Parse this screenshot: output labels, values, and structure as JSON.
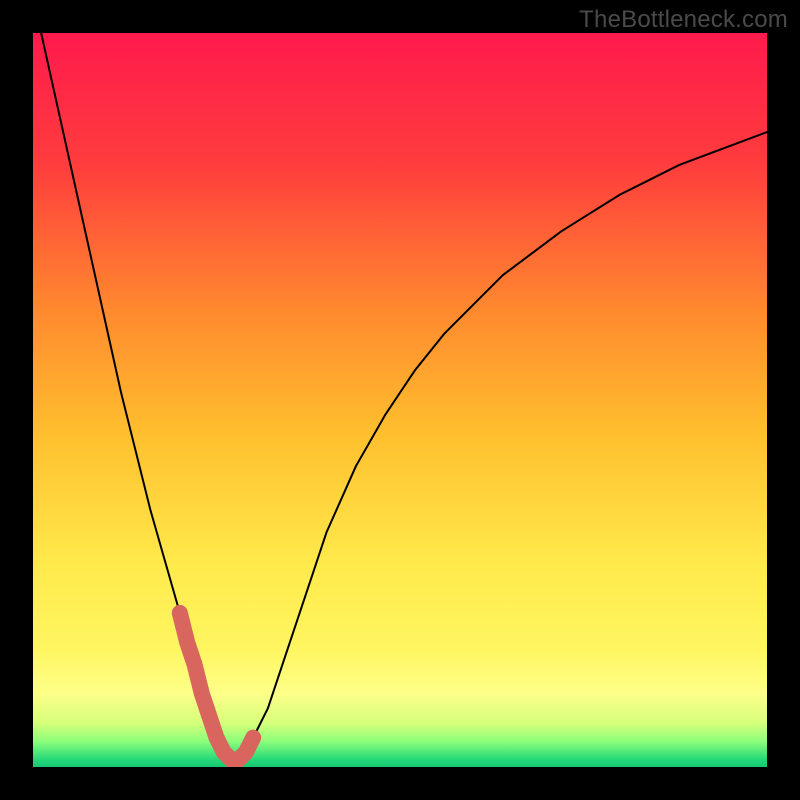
{
  "watermark": "TheBottleneck.com",
  "chart_data": {
    "type": "line",
    "title": "",
    "xlabel": "",
    "ylabel": "",
    "xlim": [
      0,
      100
    ],
    "ylim": [
      0,
      100
    ],
    "x": [
      0,
      2,
      4,
      6,
      8,
      10,
      12,
      14,
      16,
      18,
      20,
      21,
      22,
      23,
      24,
      25,
      26,
      27,
      28,
      29,
      30,
      32,
      34,
      36,
      38,
      40,
      44,
      48,
      52,
      56,
      60,
      64,
      68,
      72,
      76,
      80,
      84,
      88,
      92,
      96,
      100
    ],
    "values": [
      105,
      96,
      87,
      78,
      69,
      60,
      51,
      43,
      35,
      28,
      21,
      17,
      14,
      10,
      7,
      4,
      2,
      1,
      1,
      2,
      4,
      8,
      14,
      20,
      26,
      32,
      41,
      48,
      54,
      59,
      63,
      67,
      70,
      73,
      75.5,
      78,
      80,
      82,
      83.5,
      85,
      86.5
    ],
    "background_gradient": {
      "stops": [
        {
          "pos": 0.0,
          "color": "#ff1a4d"
        },
        {
          "pos": 0.18,
          "color": "#ff3d3d"
        },
        {
          "pos": 0.38,
          "color": "#ff8a2e"
        },
        {
          "pos": 0.55,
          "color": "#ffc02e"
        },
        {
          "pos": 0.72,
          "color": "#ffe94a"
        },
        {
          "pos": 0.84,
          "color": "#fff661"
        },
        {
          "pos": 0.9,
          "color": "#fdff88"
        },
        {
          "pos": 0.94,
          "color": "#d6ff7a"
        },
        {
          "pos": 0.965,
          "color": "#8dff7a"
        },
        {
          "pos": 0.99,
          "color": "#25d87a"
        },
        {
          "pos": 1.0,
          "color": "#14c86f"
        }
      ]
    },
    "highlight_segment": {
      "color": "#d9655f",
      "x": [
        20,
        21,
        22,
        23,
        24,
        25,
        26,
        27,
        28,
        29,
        30
      ],
      "values": [
        21,
        17,
        14,
        10,
        7,
        4,
        2,
        1,
        1,
        2,
        4
      ]
    }
  }
}
